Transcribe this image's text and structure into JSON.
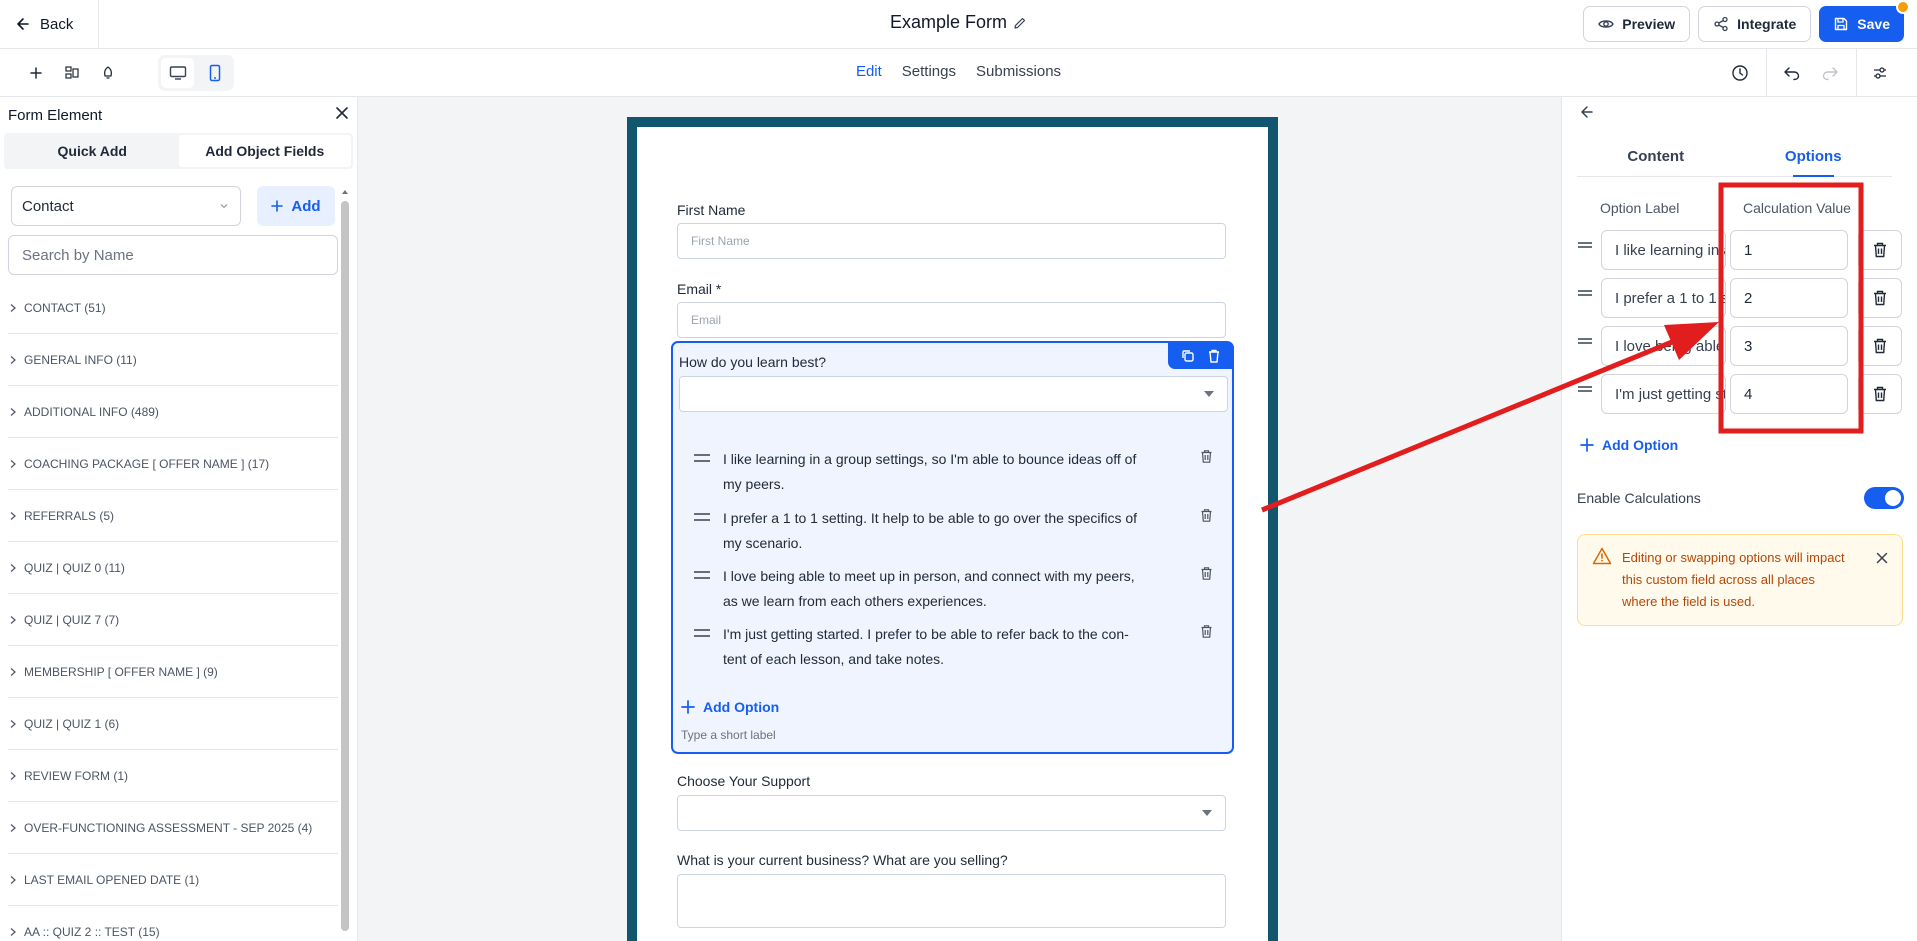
{
  "header": {
    "back_label": "Back",
    "title": "Example Form",
    "preview_label": "Preview",
    "integrate_label": "Integrate",
    "save_label": "Save"
  },
  "toolbar": {
    "tabs": [
      "Edit",
      "Settings",
      "Submissions"
    ],
    "active_tab": "Edit"
  },
  "left_panel": {
    "title": "Form Element",
    "tabs": [
      "Quick Add",
      "Add Object Fields"
    ],
    "active_tab": "Quick Add",
    "object_select": "Contact",
    "add_label": "Add",
    "search_placeholder": "Search by Name",
    "categories": [
      "CONTACT (51)",
      "GENERAL INFO (11)",
      "ADDITIONAL INFO (489)",
      "COACHING PACKAGE [ OFFER NAME ] (17)",
      "REFERRALS (5)",
      "QUIZ | QUIZ 0 (11)",
      "QUIZ | QUIZ 7 (7)",
      "MEMBERSHIP [ OFFER NAME ] (9)",
      "QUIZ | QUIZ 1 (6)",
      "REVIEW FORM (1)",
      "OVER-FUNCTIONING ASSESSMENT - SEP 2025 (4)",
      "LAST EMAIL OPENED DATE (1)",
      "AA :: QUIZ 2 :: TEST (15)"
    ]
  },
  "form": {
    "first_name_label": "First Name",
    "first_name_placeholder": "First Name",
    "email_label": "Email *",
    "email_placeholder": "Email",
    "question_label": "How do you learn best?",
    "options": [
      [
        "I like learning in a group settings, so I'm able to bounce ideas off of",
        "my peers."
      ],
      [
        "I prefer a 1 to 1 setting. It help to be able to go over the specifics of",
        "my scenario."
      ],
      [
        "I love being able to meet up in person, and connect with my peers,",
        "as we learn from each others experiences."
      ],
      [
        "I'm just getting started. I prefer to be able to refer back to the con-",
        "tent of each lesson, and take notes."
      ]
    ],
    "add_option_label": "Add Option",
    "add_option_hint": "Type a short label",
    "support_label": "Choose Your Support",
    "business_label": "What is your current business? What are you selling?"
  },
  "right_panel": {
    "tabs": [
      "Content",
      "Options"
    ],
    "active_tab": "Options",
    "col_option_label": "Option Label",
    "col_calc_value": "Calculation Value",
    "options": [
      {
        "label": "I like learning in a group settings, so I'm able to bounce ideas off of my peers.",
        "value": "1"
      },
      {
        "label": "I prefer a 1 to 1 setting. It help to be able to go over the specifics of my scenario.",
        "value": "2"
      },
      {
        "label": "I love being able to meet up in person, and connect with my peers, as we learn from each others experiences.",
        "value": "3"
      },
      {
        "label": "I'm just getting started. I prefer to be able to refer back to the content of each lesson, and take notes.",
        "value": "4"
      }
    ],
    "add_option_label": "Add Option",
    "enable_calc_label": "Enable Calculations",
    "enable_calc_on": true,
    "warning_text": "Editing or swapping options will impact this custom field across all places where the field is used."
  },
  "colors": {
    "primary": "#155eef",
    "frame": "#12556e",
    "annotation": "#e11d1d",
    "warning": "#b54708"
  }
}
